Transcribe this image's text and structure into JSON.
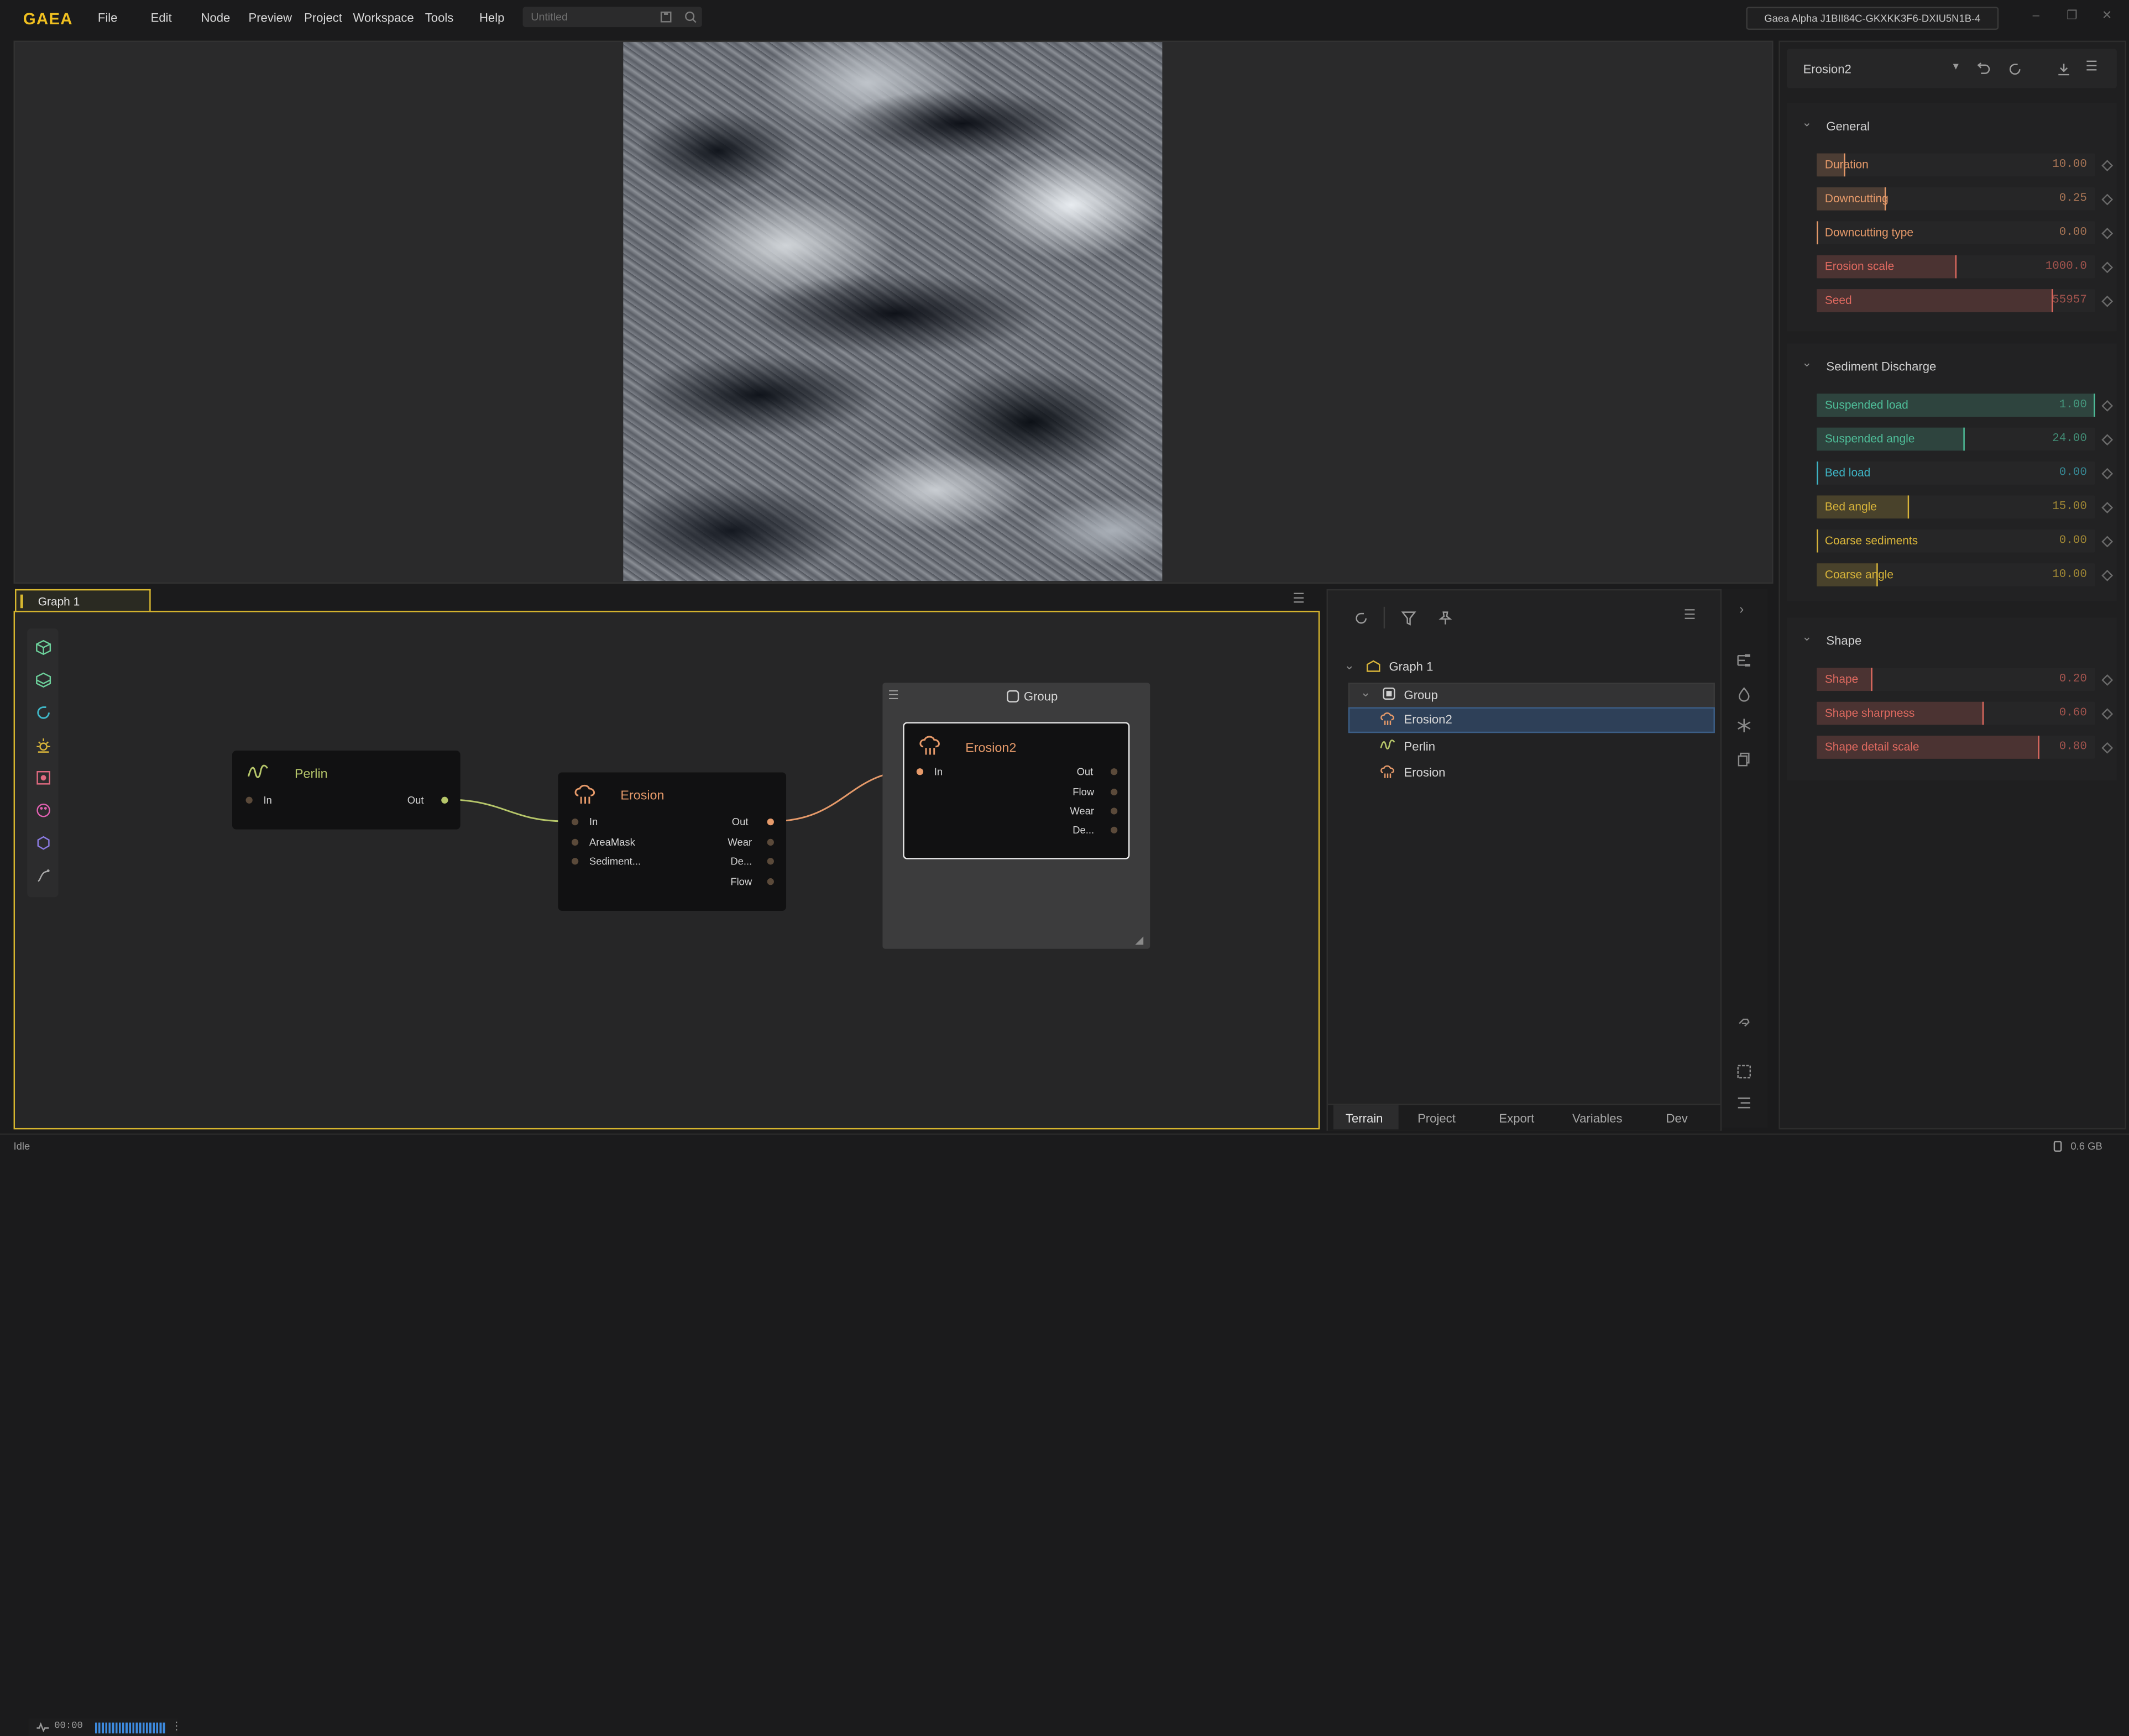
{
  "app": {
    "logo": "GAEA",
    "file_placeholder": "Untitled",
    "license": "Gaea Alpha J1BII84C-GKXKK3F6-DXIU5N1B-4"
  },
  "menu": [
    "File",
    "Edit",
    "Node",
    "Preview",
    "Project",
    "Workspace",
    "Tools",
    "Help"
  ],
  "colors": {
    "accent": "#d6b52e",
    "selection": "#2e4058",
    "erosion_orange": "#e69a6a",
    "perlin_green": "#b6c66a"
  },
  "graph": {
    "tab_label": "Graph 1",
    "toolbar_icons": [
      "cube-icon",
      "layers-icon",
      "rotate-icon",
      "sun-icon",
      "scatter-icon",
      "palette-icon",
      "hexagon-icon",
      "curve-icon"
    ],
    "nodes": {
      "perlin": {
        "title": "Perlin",
        "inputs": [
          "In"
        ],
        "outputs": [
          "Out"
        ]
      },
      "erosion": {
        "title": "Erosion",
        "inputs": [
          "In",
          "AreaMask",
          "Sediment..."
        ],
        "outputs": [
          "Out",
          "Wear",
          "De...",
          "Flow"
        ]
      },
      "erosion2": {
        "title": "Erosion2",
        "inputs": [
          "In"
        ],
        "outputs": [
          "Out",
          "Flow",
          "Wear",
          "De..."
        ]
      }
    },
    "group_title": "Group",
    "timer": "00:00"
  },
  "tree": {
    "items": [
      {
        "label": "Graph 1"
      },
      {
        "label": "Group"
      },
      {
        "label": "Erosion2"
      },
      {
        "label": "Perlin"
      },
      {
        "label": "Erosion"
      }
    ],
    "bottom_tabs": [
      "Terrain",
      "Project",
      "Export",
      "Variables",
      "Dev"
    ]
  },
  "properties": {
    "node_name": "Erosion2",
    "sections": [
      {
        "title": "General",
        "fields": [
          {
            "label": "Duration",
            "value": "10.00",
            "fraction": 0.1,
            "color": "#e69a6a"
          },
          {
            "label": "Downcutting",
            "value": "0.25",
            "fraction": 0.25,
            "color": "#e69a6a"
          },
          {
            "label": "Downcutting type",
            "value": "0.00",
            "fraction": 0.0,
            "color": "#e69a6a"
          },
          {
            "label": "Erosion scale",
            "value": "1000.0",
            "fraction": 0.5,
            "color": "#e06a60"
          },
          {
            "label": "Seed",
            "value": "55957",
            "fraction": 0.85,
            "color": "#e06a60"
          }
        ]
      },
      {
        "title": "Sediment Discharge",
        "fields": [
          {
            "label": "Suspended load",
            "value": "1.00",
            "fraction": 1.0,
            "color": "#4fbf9a"
          },
          {
            "label": "Suspended angle",
            "value": "24.00",
            "fraction": 0.53,
            "color": "#4fbf9a"
          },
          {
            "label": "Bed load",
            "value": "0.00",
            "fraction": 0.0,
            "color": "#3fb6c6"
          },
          {
            "label": "Bed angle",
            "value": "15.00",
            "fraction": 0.33,
            "color": "#d9b53a"
          },
          {
            "label": "Coarse sediments",
            "value": "0.00",
            "fraction": 0.0,
            "color": "#d9b53a"
          },
          {
            "label": "Coarse angle",
            "value": "10.00",
            "fraction": 0.22,
            "color": "#d9b53a"
          }
        ]
      },
      {
        "title": "Shape",
        "fields": [
          {
            "label": "Shape",
            "value": "0.20",
            "fraction": 0.2,
            "color": "#e06a60"
          },
          {
            "label": "Shape sharpness",
            "value": "0.60",
            "fraction": 0.6,
            "color": "#e06a60"
          },
          {
            "label": "Shape detail scale",
            "value": "0.80",
            "fraction": 0.8,
            "color": "#e06a60"
          }
        ]
      }
    ]
  },
  "status": {
    "text": "Idle",
    "memory": "0.6 GB"
  }
}
